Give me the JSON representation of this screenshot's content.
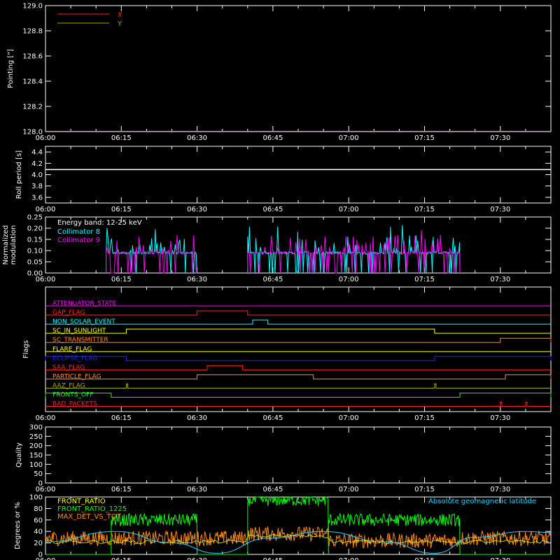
{
  "time_ticks": [
    "06:00",
    "06:15",
    "06:30",
    "06:45",
    "07:00",
    "07:15",
    "07:30"
  ],
  "colors": {
    "x": "#ff2020",
    "y": "#a8a800",
    "white": "#ffffff",
    "cyan": "#00ffff",
    "magenta": "#ff00ff",
    "green": "#00ff00",
    "ltgreen": "#80ff40",
    "orange": "#ff8c1a",
    "geo": "#20d0ff"
  },
  "chart_data": [
    {
      "id": "pointing",
      "type": "line",
      "ylabel": "Pointing [\"]",
      "ylim": [
        128.0,
        129.0
      ],
      "yticks": [
        "128.0",
        "128.2",
        "128.4",
        "128.6",
        "128.8",
        "129.0"
      ],
      "legend": [
        {
          "name": "X",
          "color": "#ff2020"
        },
        {
          "name": "Y",
          "color": "#a8a800"
        }
      ],
      "series": [
        {
          "name": "X",
          "color": "#ff2020",
          "x": [
            "06:00",
            "07:40"
          ],
          "values": [
            128.0,
            128.0
          ]
        },
        {
          "name": "Y",
          "color": "#a8a800",
          "x": [
            "06:00",
            "07:40"
          ],
          "values": [
            128.0,
            128.0
          ]
        }
      ]
    },
    {
      "id": "roll",
      "type": "line",
      "ylabel": "Roll period [s]",
      "ylim": [
        3.5,
        4.5
      ],
      "yticks": [
        "3.6",
        "3.8",
        "4.0",
        "4.2",
        "4.4"
      ],
      "series": [
        {
          "name": "",
          "color": "#ffffff",
          "x": [
            "06:00",
            "07:40"
          ],
          "values": [
            4.09,
            4.09
          ]
        }
      ]
    },
    {
      "id": "modulation",
      "type": "line",
      "ylabel": "Normalized modulation",
      "ylabel_lines": [
        "Normalized",
        "modulation"
      ],
      "ylim": [
        0.0,
        0.25
      ],
      "yticks": [
        "0.00",
        "0.05",
        "0.10",
        "0.15",
        "0.20",
        "0.25"
      ],
      "legend_title": "Energy band: 12-25 keV",
      "legend": [
        {
          "name": "Collimator 8",
          "color": "#00ffff"
        },
        {
          "name": "Collimator 9",
          "color": "#ff00ff"
        }
      ],
      "active_intervals": [
        [
          "06:12",
          "06:30"
        ],
        [
          "06:40",
          "07:22"
        ]
      ],
      "baseline": 0.09
    },
    {
      "id": "flags",
      "type": "line",
      "ylabel": "Flags",
      "flags": [
        {
          "name": "ATTENUATOR_STATE",
          "color": "#ff00ff",
          "steps": []
        },
        {
          "name": "GAP_FLAG",
          "color": "#ff2020",
          "steps": [
            [
              "06:30",
              "06:40"
            ]
          ]
        },
        {
          "name": "NON_SOLAR_EVENT",
          "color": "#00ffff",
          "steps": [
            [
              "06:41",
              "06:44"
            ]
          ]
        },
        {
          "name": "SC_IN_SUNLIGHT",
          "color": "#ffff00",
          "steps": [
            [
              "06:16",
              "07:17"
            ]
          ]
        },
        {
          "name": "SC_TRANSMITTER",
          "color": "#ff8c1a",
          "steps": [
            [
              "07:30",
              "07:40"
            ]
          ]
        },
        {
          "name": "FLARE_FLAG",
          "color": "#ffff00",
          "steps": []
        },
        {
          "name": "ECLIPSE_FLAG",
          "color": "#2020ff",
          "steps": [
            [
              "06:00",
              "06:16"
            ],
            [
              "07:17",
              "07:40"
            ]
          ]
        },
        {
          "name": "SAA_FLAG",
          "color": "#ff2020",
          "steps": [
            [
              "06:32",
              "06:39"
            ]
          ]
        },
        {
          "name": "PARTICLE_FLAG",
          "color": "#ff8c1a",
          "steps": [
            [
              "06:30",
              "06:53"
            ],
            [
              "07:31",
              "07:40"
            ]
          ]
        },
        {
          "name": "AAZ_FLAG",
          "color": "#a8a800",
          "steps": [
            [
              "06:16",
              "06:16"
            ],
            [
              "07:17",
              "07:17"
            ]
          ]
        },
        {
          "name": "FRONTS_OFF",
          "color": "#00ff00",
          "steps": [
            [
              "06:00",
              "06:13"
            ],
            [
              "07:22",
              "07:40"
            ]
          ]
        },
        {
          "name": "BAD_PACKETS",
          "color": "#ff2020",
          "steps": [
            [
              "07:30",
              "07:30"
            ],
            [
              "07:35",
              "07:35"
            ]
          ]
        }
      ]
    },
    {
      "id": "quality",
      "type": "line",
      "ylabel": "Quality",
      "ylim": [
        0,
        300
      ],
      "yticks": [
        "0",
        "50",
        "100",
        "150",
        "200",
        "250",
        "300"
      ],
      "series": []
    },
    {
      "id": "ratios",
      "type": "line",
      "ylabel": "Degrees or %",
      "ylim": [
        0,
        100
      ],
      "yticks": [
        "0",
        "20",
        "40",
        "60",
        "80",
        "100"
      ],
      "legend": [
        {
          "name": "FRONT_RATIO",
          "color": "#ffff00"
        },
        {
          "name": "FRONT_RATIO_1225",
          "color": "#00ff00"
        },
        {
          "name": "MAX_DET_VS_TOT",
          "color": "#ff8c1a"
        }
      ],
      "right_legend": {
        "name": "Absolute geomagnetic latitude",
        "color": "#20d0ff"
      },
      "front_ratio_1225_segments": [
        {
          "x": [
            "06:13",
            "06:30"
          ],
          "level": 60
        },
        {
          "x": [
            "06:40",
            "06:56"
          ],
          "level": 95
        },
        {
          "x": [
            "06:56",
            "07:22"
          ],
          "level": 60
        }
      ],
      "geomag_latitude": {
        "x": [
          "06:00",
          "06:14",
          "06:25",
          "06:34",
          "06:44",
          "06:55",
          "07:07",
          "07:17",
          "07:25",
          "07:35",
          "07:40"
        ],
        "values": [
          22,
          40,
          20,
          2,
          28,
          40,
          22,
          2,
          30,
          40,
          38
        ]
      }
    }
  ]
}
